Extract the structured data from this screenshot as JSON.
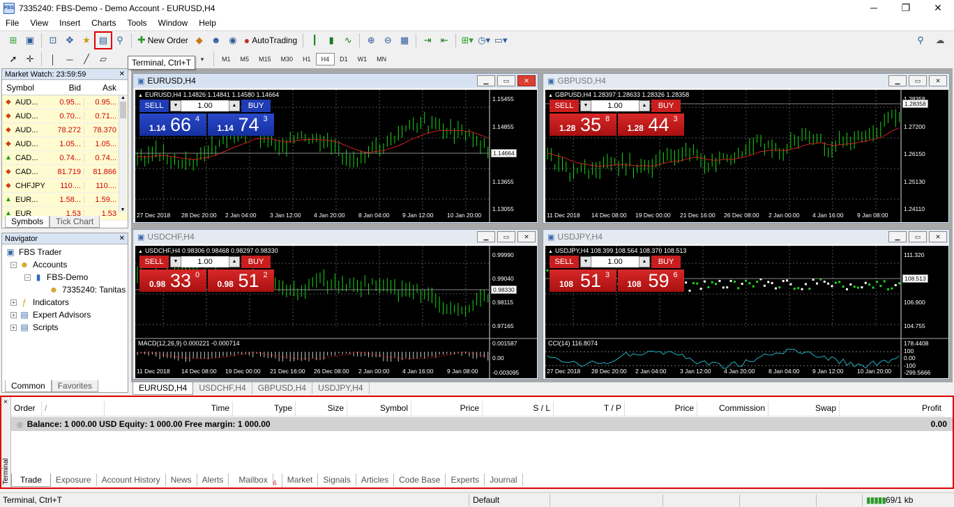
{
  "window": {
    "title": "7335240: FBS-Demo - Demo Account - EURUSD,H4",
    "icon_text": "FBS",
    "min": "─",
    "max": "❐",
    "close": "✕"
  },
  "menu": [
    "File",
    "View",
    "Insert",
    "Charts",
    "Tools",
    "Window",
    "Help"
  ],
  "toolbar": {
    "new_order": "New Order",
    "autotrading": "AutoTrading",
    "tooltip": "Terminal, Ctrl+T"
  },
  "timeframes": [
    "M1",
    "M5",
    "M15",
    "M30",
    "H1",
    "H4",
    "D1",
    "W1",
    "MN"
  ],
  "active_timeframe": "H4",
  "market_watch": {
    "title": "Market Watch: 23:59:59",
    "headers": {
      "symbol": "Symbol",
      "bid": "Bid",
      "ask": "Ask"
    },
    "rows": [
      {
        "dir": "down",
        "symbol": "AUD...",
        "bid": "0.95...",
        "ask": "0.95..."
      },
      {
        "dir": "down",
        "symbol": "AUD...",
        "bid": "0.70...",
        "ask": "0.71..."
      },
      {
        "dir": "down",
        "symbol": "AUD...",
        "bid": "78.272",
        "ask": "78.370"
      },
      {
        "dir": "down",
        "symbol": "AUD...",
        "bid": "1.05...",
        "ask": "1.05..."
      },
      {
        "dir": "up",
        "symbol": "CAD...",
        "bid": "0.74...",
        "ask": "0.74..."
      },
      {
        "dir": "down",
        "symbol": "CAD...",
        "bid": "81.719",
        "ask": "81.866"
      },
      {
        "dir": "down",
        "symbol": "CHFJPY",
        "bid": "110....",
        "ask": "110...."
      },
      {
        "dir": "up",
        "symbol": "EUR...",
        "bid": "1.58...",
        "ask": "1.59..."
      },
      {
        "dir": "up",
        "symbol": "EUR",
        "bid": "1.53",
        "ask": "1.53"
      }
    ],
    "tabs": [
      "Symbols",
      "Tick Chart"
    ]
  },
  "navigator": {
    "title": "Navigator",
    "root": "FBS Trader",
    "accounts": "Accounts",
    "server": "FBS-Demo",
    "account": "7335240: Tanitas",
    "indicators": "Indicators",
    "experts": "Expert Advisors",
    "scripts": "Scripts",
    "tabs": [
      "Common",
      "Favorites"
    ]
  },
  "charts": [
    {
      "title": "EURUSD,H4",
      "info": "EURUSD,H4  1.14826 1.14841 1.14580 1.14664",
      "color": "blue",
      "sell_small": "1.14",
      "sell_big": "66",
      "sell_sup": "4",
      "buy_small": "1.14",
      "buy_big": "74",
      "buy_sup": "3",
      "volume": "1.00",
      "sell": "SELL",
      "buy": "BUY",
      "yticks": [
        "1.15455",
        "1.14855",
        "1.14255",
        "1.13655",
        "1.13055"
      ],
      "price": "1.14664",
      "xticks": [
        "27 Dec 2018",
        "28 Dec 20:00",
        "2 Jan 04:00",
        "3 Jan 12:00",
        "4 Jan 20:00",
        "8 Jan 04:00",
        "9 Jan 12:00",
        "10 Jan 20:00"
      ]
    },
    {
      "title": "GBPUSD,H4",
      "info": "GBPUSD,H4  1.28397 1.28633 1.28326 1.28358",
      "color": "red",
      "sell_small": "1.28",
      "sell_big": "35",
      "sell_sup": "8",
      "buy_small": "1.28",
      "buy_big": "44",
      "buy_sup": "3",
      "volume": "1.00",
      "sell": "SELL",
      "buy": "BUY",
      "yticks": [
        "1.28358",
        "1.27200",
        "1.26150",
        "1.25130",
        "1.24110"
      ],
      "price": "1.28358",
      "xticks": [
        "11 Dec 2018",
        "14 Dec 08:00",
        "19 Dec 00:00",
        "21 Dec 16:00",
        "26 Dec 08:00",
        "2 Jan 00:00",
        "4 Jan 16:00",
        "9 Jan 08:00"
      ]
    },
    {
      "title": "USDCHF,H4",
      "info": "USDCHF,H4  0.98306 0.98468 0.98297 0.98330",
      "color": "red",
      "sell_small": "0.98",
      "sell_big": "33",
      "sell_sup": "0",
      "buy_small": "0.98",
      "buy_big": "51",
      "buy_sup": "2",
      "volume": "1.00",
      "sell": "SELL",
      "buy": "BUY",
      "yticks": [
        "0.99990",
        "0.99040",
        "0.98115",
        "0.97165"
      ],
      "price": "0.98330",
      "sub_label": "MACD(12,26,9) 0.000221 -0.000714",
      "sub_yticks": [
        "0.001587",
        "0.00",
        "-0.003095"
      ],
      "xticks": [
        "11 Dec 2018",
        "14 Dec 08:00",
        "19 Dec 00:00",
        "21 Dec 16:00",
        "26 Dec 08:00",
        "2 Jan 00:00",
        "4 Jan 16:00",
        "9 Jan 08:00"
      ]
    },
    {
      "title": "USDJPY,H4",
      "info": "USDJPY,H4  108.399 108.564 108.370 108.513",
      "color": "red",
      "sell_small": "108",
      "sell_big": "51",
      "sell_sup": "3",
      "buy_small": "108",
      "buy_big": "59",
      "buy_sup": "6",
      "volume": "1.00",
      "sell": "SELL",
      "buy": "BUY",
      "yticks": [
        "111.320",
        "109.110",
        "106.900",
        "104.755"
      ],
      "price": "108.513",
      "sub_label": "CCI(14) 116.8074",
      "sub_yticks": [
        "178.4408",
        "100",
        "0.00",
        "-100",
        "-299.5666"
      ],
      "xticks": [
        "27 Dec 2018",
        "28 Dec 20:00",
        "2 Jan 04:00",
        "3 Jan 12:00",
        "4 Jan 20:00",
        "8 Jan 04:00",
        "9 Jan 12:00",
        "10 Jan 20:00"
      ]
    }
  ],
  "chart_tabs": [
    "EURUSD,H4",
    "USDCHF,H4",
    "GBPUSD,H4",
    "USDJPY,H4"
  ],
  "terminal": {
    "side_label": "Terminal",
    "close": "×",
    "headers": [
      "Order",
      "/",
      "Time",
      "Type",
      "Size",
      "Symbol",
      "Price",
      "S / L",
      "T / P",
      "Price",
      "Commission",
      "Swap",
      "Profit"
    ],
    "balance": "Balance: 1 000.00 USD  Equity: 1 000.00  Free margin: 1 000.00",
    "profit": "0.00",
    "tabs": [
      "Trade",
      "Exposure",
      "Account History",
      "News",
      "Alerts",
      "Mailbox",
      "Market",
      "Signals",
      "Articles",
      "Code Base",
      "Experts",
      "Journal"
    ],
    "mailbox_count": "6"
  },
  "status": {
    "hint": "Terminal, Ctrl+T",
    "profile": "Default",
    "traffic": "69/1 kb"
  }
}
